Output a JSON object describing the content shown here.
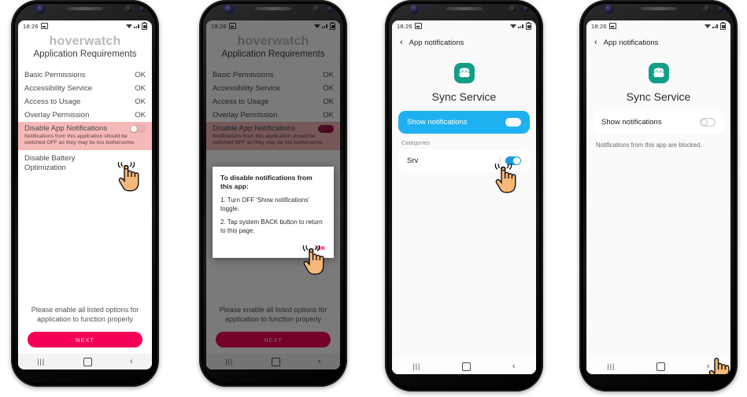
{
  "status_bar": {
    "time": "18:26",
    "icons": [
      "picture-icon",
      "wifi-icon",
      "signal-icon",
      "battery-icon"
    ]
  },
  "nav_bar": {
    "recent": "|||",
    "home": "home-square",
    "back": "‹"
  },
  "phone1": {
    "app": {
      "logo": "hoverwatch",
      "title": "Application Requirements",
      "rows": [
        {
          "label": "Basic Permissions",
          "status": "OK"
        },
        {
          "label": "Accessibility Service",
          "status": "OK"
        },
        {
          "label": "Access to Usage",
          "status": "OK"
        },
        {
          "label": "Overlay Permission",
          "status": "OK"
        }
      ],
      "highlight_row": {
        "label": "Disable App Notifications",
        "toggle_state": "off",
        "note": "Notifications from this application should be switched OFF as they may be too bothersome."
      },
      "last_row": {
        "label": "Disable Battery Optimization"
      },
      "footer": "Please enable all listed options for application to function properly",
      "next_button": "NEXT"
    }
  },
  "phone2": {
    "app": {
      "logo": "hoverwatch",
      "title": "Application Requirements",
      "rows": [
        {
          "label": "Basic Permissions",
          "status": "OK"
        },
        {
          "label": "Accessibility Service",
          "status": "OK"
        },
        {
          "label": "Access to Usage",
          "status": "OK"
        },
        {
          "label": "Overlay Permission",
          "status": "OK"
        }
      ],
      "highlight_row": {
        "label": "Disable App Notifications",
        "toggle_state": "on",
        "note": "Notifications from this application should be switched OFF as they may be too bothersome."
      },
      "footer": "Please enable all listed options for application to function properly",
      "next_button": "NEXT"
    },
    "dialog": {
      "title": "To disable notifications from this app:",
      "step1": "1. Turn OFF 'Show notifications' toggle.",
      "step2": "2. Tap system BACK button to return to this page.",
      "ok_button": "OK"
    }
  },
  "phone3": {
    "header": {
      "back": "‹",
      "title": "App notifications"
    },
    "app_name": "Sync Service",
    "app_icon": "android-robot-icon",
    "show_notifications": {
      "label": "Show notifications",
      "toggle_state": "on",
      "highlighted": true
    },
    "categories_label": "Categories",
    "category_rows": [
      {
        "label": "Srv",
        "toggle_state": "on"
      }
    ]
  },
  "phone4": {
    "header": {
      "back": "‹",
      "title": "App notifications"
    },
    "app_name": "Sync Service",
    "app_icon": "android-robot-icon",
    "show_notifications": {
      "label": "Show notifications",
      "toggle_state": "off",
      "highlighted": false
    },
    "blocked_note": "Notifications from this app are blocked."
  },
  "colors": {
    "brand_pink": "#f50057",
    "highlight_pink": "#f6b9b9",
    "android_blue": "#1eb0f0",
    "app_icon_teal": "#129e86",
    "hand_skin": "#f4b878"
  }
}
